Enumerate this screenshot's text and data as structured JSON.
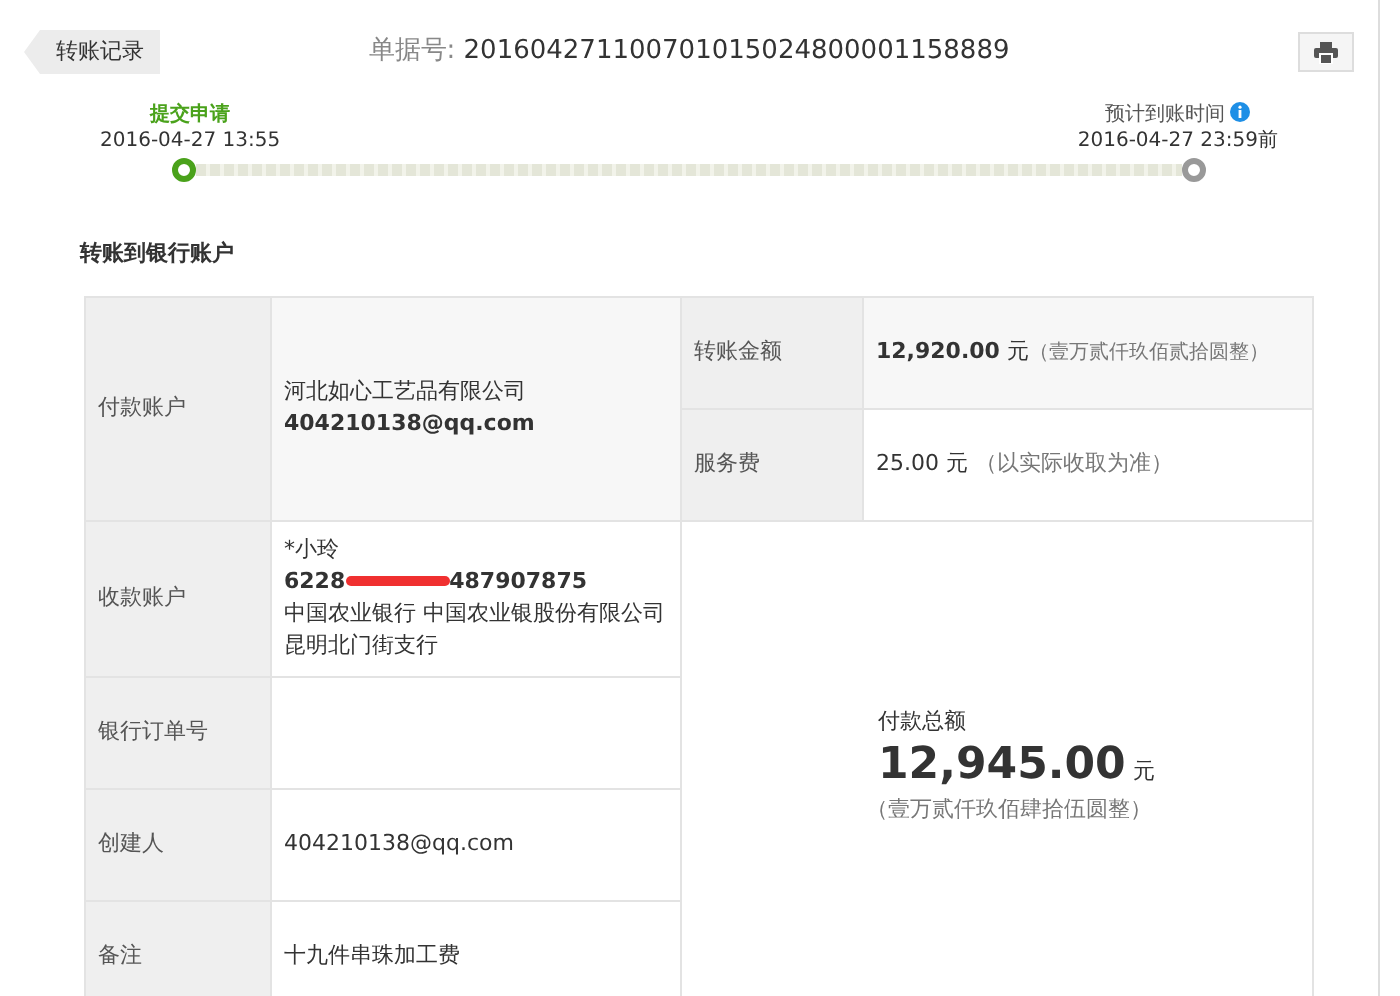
{
  "back_button": "转账记录",
  "order": {
    "label": "单据号:",
    "number": "201604271100701015024800001158889"
  },
  "steps": [
    {
      "label": "提交申请",
      "time": "2016-04-27 13:55",
      "done": true,
      "info": false
    },
    {
      "label": "预计到账时间",
      "time": "2016-04-27 23:59前",
      "done": false,
      "info": true
    }
  ],
  "section_title": "转账到银行账户",
  "payer": {
    "label": "付款账户",
    "name": "河北如心工艺品有限公司",
    "account": "404210138@qq.com"
  },
  "amount": {
    "label": "转账金额",
    "value": "12,920.00",
    "unit": "元",
    "words": "（壹万贰仟玖佰贰拾圆整）"
  },
  "fee": {
    "label": "服务费",
    "value": "25.00",
    "unit": "元",
    "note": "（以实际收取为准）"
  },
  "payee": {
    "label": "收款账户",
    "name": "*小玲",
    "card_start": "6228",
    "card_end": "487907875",
    "redacted": true,
    "bank": "中国农业银行 中国农业银股份有限公司昆明北门街支行"
  },
  "bank_order": {
    "label": "银行订单号"
  },
  "creator": {
    "label": "创建人",
    "value": "404210138@qq.com"
  },
  "memo": {
    "label": "备注",
    "value": "十九件串珠加工费"
  },
  "total": {
    "label": "付款总额",
    "value": "12,945.00",
    "unit": "元",
    "words": "（壹万贰仟玖佰肆拾伍圆整）"
  }
}
